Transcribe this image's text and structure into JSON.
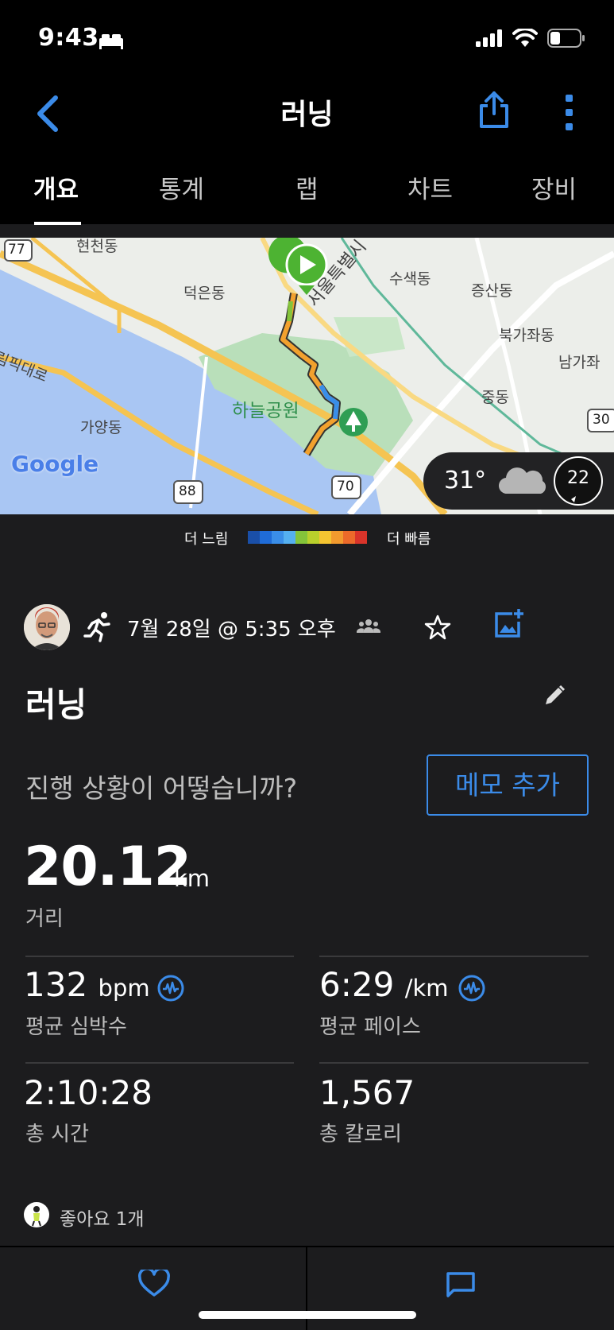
{
  "status_bar": {
    "time": "9:43",
    "icons": [
      "bed-icon",
      "signal-icon",
      "wifi-icon",
      "battery-icon"
    ]
  },
  "nav": {
    "title": "러닝",
    "icons": [
      "back-chevron-icon",
      "share-icon",
      "more-vertical-icon"
    ],
    "accent_color": "#3b8be8"
  },
  "tabs": [
    {
      "label": "개요",
      "active": true
    },
    {
      "label": "통계",
      "active": false
    },
    {
      "label": "랩",
      "active": false
    },
    {
      "label": "차트",
      "active": false
    },
    {
      "label": "장비",
      "active": false
    }
  ],
  "map": {
    "labels": {
      "hyeoncheon": "현천동",
      "deogeun": "덕은동",
      "susaek": "수색동",
      "jeungsan": "증산동",
      "bukgajwa": "북가좌동",
      "namgajwa": "남가좌",
      "jung": "중동",
      "gayang": "가양동",
      "haneul_park": "하늘공원",
      "olympic_road": "림픽대로",
      "seoul_ring": "서울특별시"
    },
    "route_shields": [
      "77",
      "88",
      "70",
      "30"
    ],
    "attribution": "Google",
    "weather": {
      "temperature": "31°",
      "wind": "22",
      "icons": [
        "cloud-icon",
        "wind-compass-icon"
      ]
    }
  },
  "legend": {
    "slower_label": "더 느림",
    "faster_label": "더 빠름",
    "colors": [
      "#1a4fa8",
      "#1f6cd8",
      "#3a8ee8",
      "#55b0f0",
      "#84c43a",
      "#b9d02c",
      "#f4c431",
      "#f29a2e",
      "#ec6a2a",
      "#d9342a"
    ]
  },
  "activity": {
    "date": "7월 28일 @ 5:35 오후",
    "title": "러닝",
    "prompt": "진행 상황이 어떻습니까?",
    "memo_button": "메모 추가",
    "icons": [
      "avatar",
      "running-person-icon",
      "group-icon",
      "star-icon",
      "add-photo-icon",
      "pencil-icon"
    ]
  },
  "stats": {
    "distance": {
      "value": "20.12",
      "unit": "km",
      "label": "거리"
    },
    "heart_rate": {
      "value": "132",
      "unit": "bpm",
      "label": "평균 심박수"
    },
    "pace": {
      "value": "6:29",
      "unit": "/km",
      "label": "평균 페이스"
    },
    "time": {
      "value": "2:10:28",
      "label": "총 시간"
    },
    "calories": {
      "value": "1,567",
      "label": "총 칼로리"
    }
  },
  "likes": {
    "text": "좋아요 1개"
  },
  "bottom_bar": {
    "icons": [
      "heart-icon",
      "comment-icon"
    ]
  }
}
